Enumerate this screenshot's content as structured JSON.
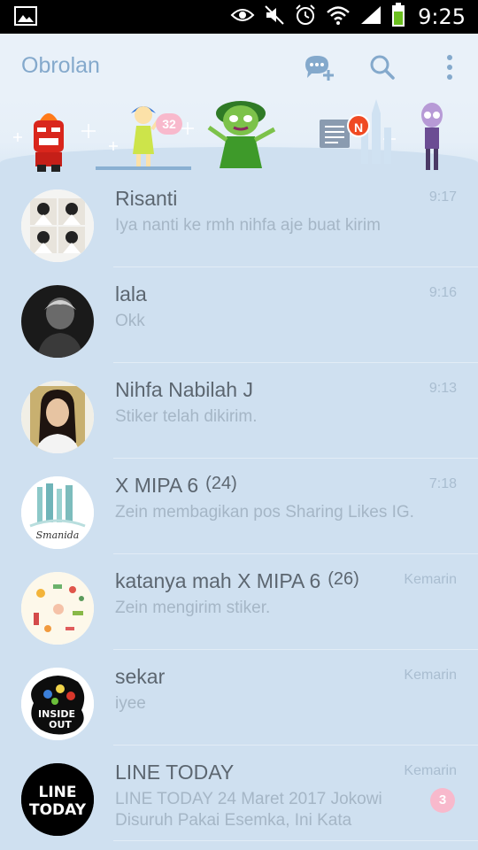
{
  "status_bar": {
    "time": "9:25",
    "icons": [
      "image-icon",
      "eye-icon",
      "mute-icon",
      "alarm-icon",
      "wifi-icon",
      "signal-icon",
      "battery-icon"
    ]
  },
  "header": {
    "title": "Obrolan",
    "icons": [
      "new-chat-icon",
      "search-icon",
      "more-vertical-icon"
    ]
  },
  "tabs": [
    {
      "name": "anger-sticker-tab"
    },
    {
      "name": "joy-sticker-tab",
      "badge": "32"
    },
    {
      "name": "disgust-sticker-tab"
    },
    {
      "name": "timeline-tab",
      "badge": "N"
    },
    {
      "name": "fear-sticker-tab"
    }
  ],
  "chats": [
    {
      "name": "Risanti",
      "count": "",
      "time": "9:17",
      "message": "Iya nanti ke rmh nihfa aje buat kirim",
      "unread": ""
    },
    {
      "name": "lala",
      "count": "",
      "time": "9:16",
      "message": "Okk",
      "unread": ""
    },
    {
      "name": "Nihfa Nabilah J",
      "count": "",
      "time": "9:13",
      "message": "Stiker telah dikirim.",
      "unread": ""
    },
    {
      "name": "X MIPA 6",
      "count": "(24)",
      "time": "7:18",
      "message": "Zein membagikan pos Sharing Likes IG.",
      "unread": ""
    },
    {
      "name": "katanya mah X MIPA 6",
      "count": "(26)",
      "time": "Kemarin",
      "message": "Zein mengirim stiker.",
      "unread": ""
    },
    {
      "name": "sekar",
      "count": "",
      "time": "Kemarin",
      "message": "iyee",
      "unread": ""
    },
    {
      "name": "LINE TODAY",
      "count": "",
      "time": "Kemarin",
      "message": "LINE TODAY 24 Maret 2017 Jokowi Disuruh Pakai Esemka, Ini Kata",
      "unread": "3"
    }
  ],
  "avatar_texts": {
    "xmipa": "Smanida",
    "sekar_line1": "INSIDE",
    "sekar_line2": "OUT",
    "linetoday_line1": "LINE",
    "linetoday_line2": "TODAY"
  },
  "colors": {
    "background": "#cfe0f0",
    "header": "#e9f1f9",
    "accent": "#84a9cc",
    "badge_pink": "#f8b9cc",
    "badge_red": "#f04a23"
  }
}
